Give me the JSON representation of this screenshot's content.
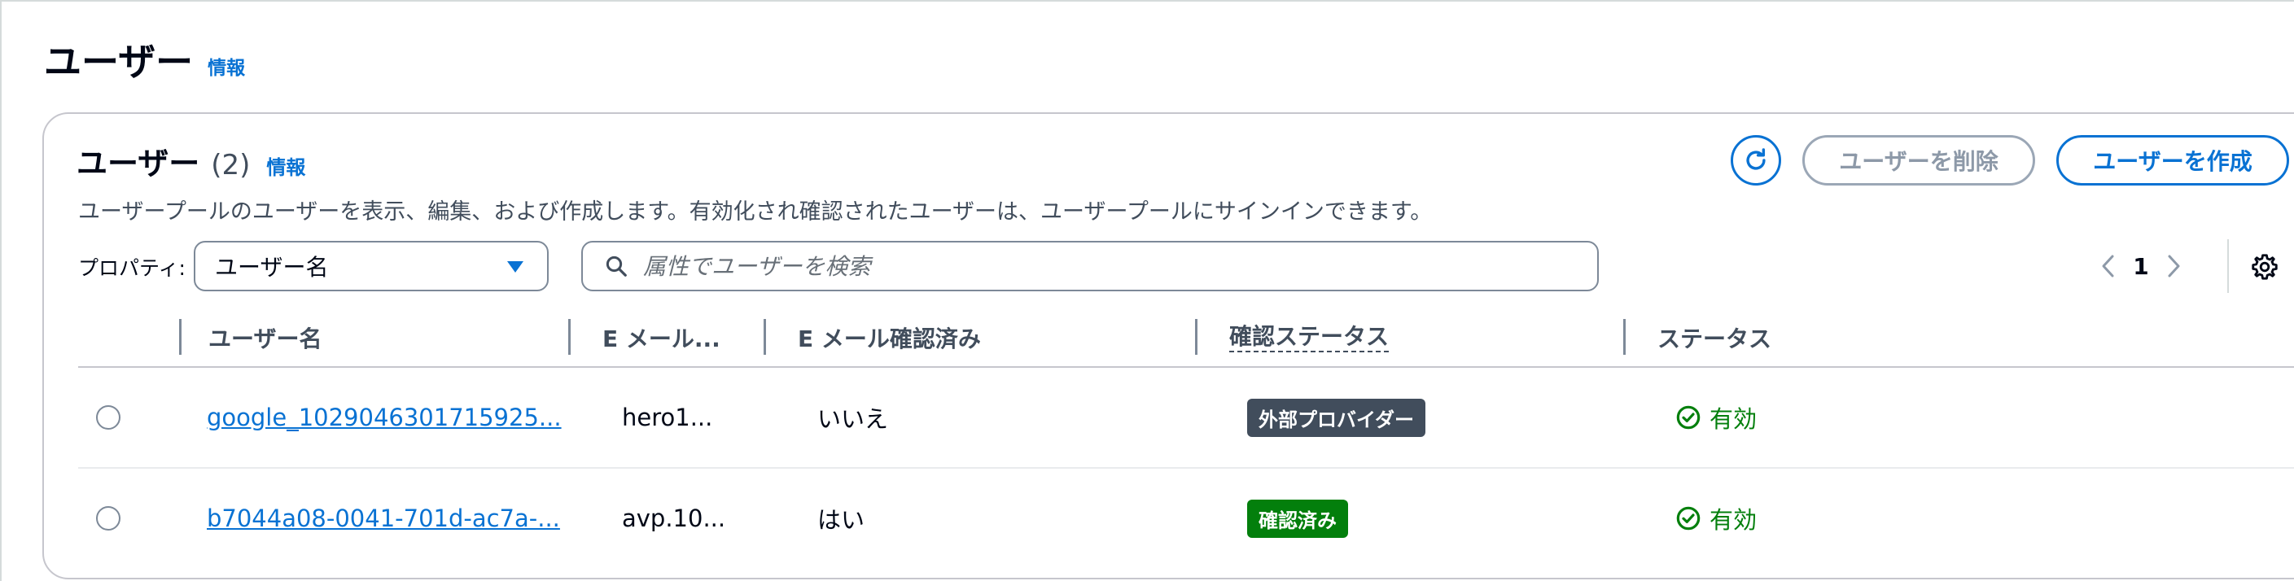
{
  "page": {
    "title": "ユーザー",
    "info": "情報"
  },
  "container": {
    "title": "ユーザー",
    "count": "(2)",
    "info": "情報",
    "description": "ユーザープールのユーザーを表示、編集、および作成します。有効化され確認されたユーザーは、ユーザープールにサインインできます。",
    "refresh_icon": "refresh-icon",
    "delete_label": "ユーザーを削除",
    "create_label": "ユーザーを作成"
  },
  "filter": {
    "property_label": "プロパティ:",
    "property_value": "ユーザー名",
    "search_placeholder": "属性でユーザーを検索"
  },
  "pagination": {
    "current_page": "1"
  },
  "table": {
    "columns": [
      "ユーザー名",
      "E メール...",
      "E メール確認済み",
      "確認ステータス",
      "ステータス"
    ],
    "rows": [
      {
        "username": "google_1029046301715925...",
        "email": "hero1...",
        "email_verified": "いいえ",
        "confirmation_status": "外部プロバイダー",
        "status": "有効"
      },
      {
        "username": "b7044a08-0041-701d-ac7a-...",
        "email": "avp.10...",
        "email_verified": "はい",
        "confirmation_status": "確認済み",
        "status": "有効"
      }
    ]
  },
  "colors": {
    "accent": "#0972d3",
    "success": "#037f0c",
    "badge_dark": "#414d5c"
  }
}
